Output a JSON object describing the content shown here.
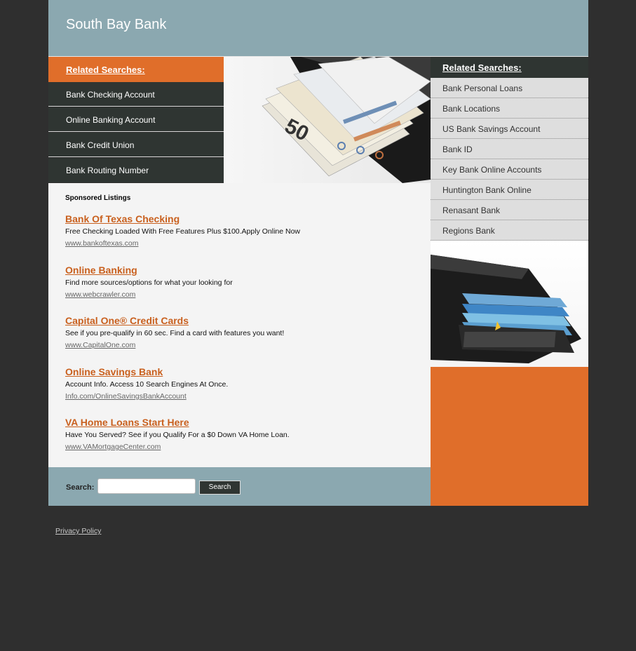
{
  "site": {
    "title": "South Bay Bank"
  },
  "left_nav": {
    "title": "Related Searches:",
    "items": [
      {
        "label": "Bank Checking Account"
      },
      {
        "label": "Online Banking Account"
      },
      {
        "label": "Bank Credit Union"
      },
      {
        "label": "Bank Routing Number"
      }
    ]
  },
  "hero": {
    "note_value": "50"
  },
  "sponsored": {
    "title": "Sponsored Listings",
    "listings": [
      {
        "title": "Bank Of Texas Checking",
        "desc": "Free Checking Loaded With Free Features Plus $100.Apply Online Now",
        "url": "www.bankoftexas.com"
      },
      {
        "title": "Online Banking",
        "desc": "Find more sources/options for what your looking for",
        "url": "www.webcrawler.com"
      },
      {
        "title": "Capital One® Credit Cards",
        "desc": "See if you pre-qualify in 60 sec. Find a card with features you want!",
        "url": "www.CapitalOne.com"
      },
      {
        "title": "Online Savings Bank",
        "desc": "Account Info. Access 10 Search Engines At Once.",
        "url": "Info.com/OnlineSavingsBankAccount"
      },
      {
        "title": "VA Home Loans Start Here",
        "desc": "Have You Served? See if you Qualify For a $0 Down VA Home Loan.",
        "url": "www.VAMortgageCenter.com"
      }
    ]
  },
  "search": {
    "label": "Search:",
    "placeholder": "",
    "button": "Search"
  },
  "right_nav": {
    "title": "Related Searches:",
    "items": [
      {
        "label": "Bank Personal Loans"
      },
      {
        "label": "Bank Locations"
      },
      {
        "label": "US Bank Savings Account"
      },
      {
        "label": "Bank ID"
      },
      {
        "label": "Key Bank Online Accounts"
      },
      {
        "label": "Huntington Bank Online"
      },
      {
        "label": "Renasant Bank"
      },
      {
        "label": "Regions Bank"
      }
    ]
  },
  "footer": {
    "privacy": "Privacy Policy"
  },
  "colors": {
    "accent": "#e06e2a",
    "dark": "#2f3532",
    "header": "#8ba8b0",
    "page_bg": "#2f2f2f"
  }
}
